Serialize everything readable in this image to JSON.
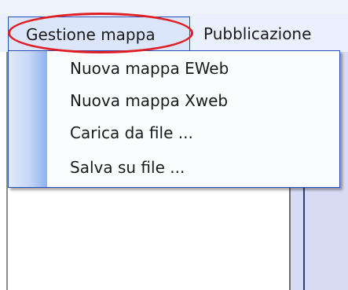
{
  "menubar": {
    "menus": [
      {
        "label": "Gestione mappa"
      },
      {
        "label": "Pubblicazione"
      }
    ]
  },
  "dropdown": {
    "items": [
      {
        "label": "Nuova mappa EWeb"
      },
      {
        "label": "Nuova mappa Xweb"
      },
      {
        "label": "Carica da file ..."
      },
      {
        "label": "Salva su file ..."
      }
    ]
  },
  "annotation": {
    "color": "#e01f25",
    "shape": "ellipse"
  }
}
